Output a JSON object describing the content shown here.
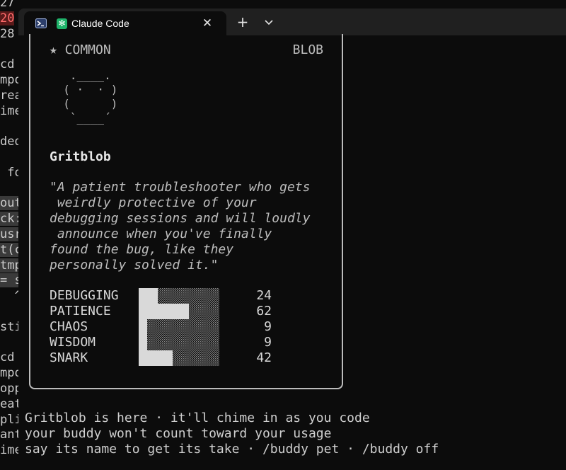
{
  "background_terminal": {
    "lines": [
      "27",
      "20",
      "28",
      "",
      "cd",
      "mpo",
      "rea",
      "ime",
      "",
      "ded",
      "",
      " fo",
      "",
      "out",
      "ck:",
      "usr",
      "t(c",
      "tmp",
      "= s",
      "  ^",
      "",
      "sti",
      "",
      "cd",
      "mpo",
      "opp",
      "eat",
      "pli",
      "ant",
      "ime"
    ]
  },
  "window": {
    "tab_title": "Claude Code",
    "tab_icon_glyph": "✻",
    "close_glyph": "✕",
    "new_tab_glyph": "+",
    "profile_icon": "powershell-icon",
    "dropdown_icon": "chevron-down-icon"
  },
  "card": {
    "rarity": "★ COMMON",
    "species": "BLOB",
    "ascii_art": "   .____.\n  ( ·  · )\n  (      )\n   `____´",
    "name": "Gritblob",
    "quote": "\"A patient troubleshooter who gets\n weirdly protective of your\ndebugging sessions and will loudly\n announce when you've finally\nfound the bug, like they\npersonally solved it.\"",
    "stats": [
      {
        "label": "DEBUGGING",
        "value": 24
      },
      {
        "label": "PATIENCE",
        "value": 62
      },
      {
        "label": "CHAOS",
        "value": 9
      },
      {
        "label": "WISDOM",
        "value": 9
      },
      {
        "label": "SNARK",
        "value": 42
      }
    ],
    "stat_max": 100
  },
  "footer": {
    "line1": "Gritblob is here · it'll chime in as you code",
    "line2": "your buddy won't count toward your usage",
    "line3": "say its name to get its take · /buddy pet · /buddy off"
  },
  "colors": {
    "background": "#0c0c0c",
    "tabbar": "#202020",
    "accent_icon": "#1fb36a",
    "bar_fill": "#d9d9d9"
  }
}
